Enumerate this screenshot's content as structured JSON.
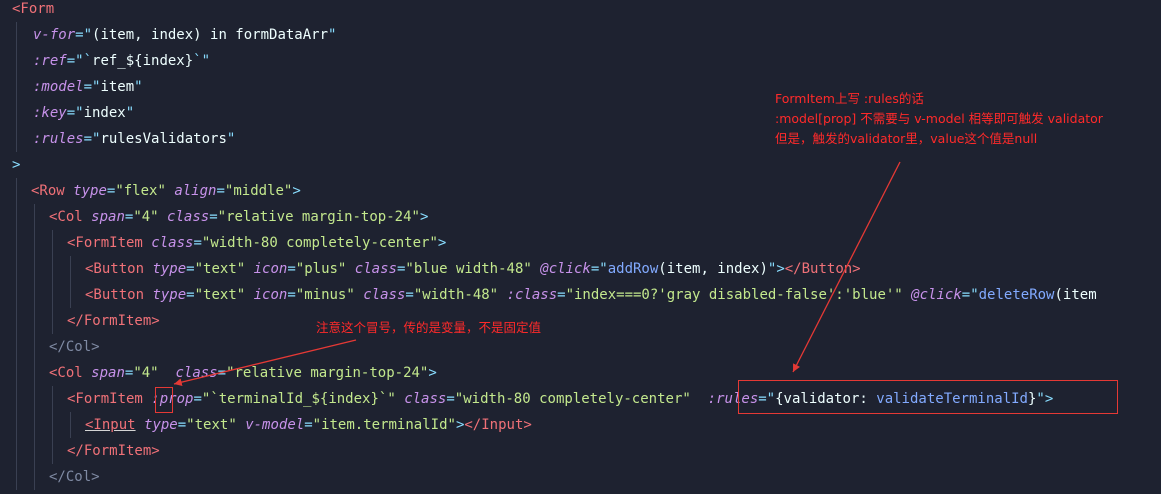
{
  "colors": {
    "background": "#1e2230",
    "tag": "#f07178",
    "attribute": "#c792ea",
    "string": "#c3e88d",
    "punctuation": "#89ddff",
    "function": "#82aaff",
    "annotation": "#ff2a2a"
  },
  "code": {
    "l1_tag": "<Form",
    "l2_attr": "v-for",
    "l2_eq": "=\"",
    "l2_val": "(item, index) in formDataArr",
    "l2_q": "\"",
    "l3_attr": ":ref",
    "l3_eq": "=\"`",
    "l3_val": "ref_${index}",
    "l3_q": "`\"",
    "l4_attr": ":model",
    "l4_eq": "=\"",
    "l4_val": "item",
    "l4_q": "\"",
    "l5_attr": ":key",
    "l5_eq": "=\"",
    "l5_val": "index",
    "l5_q": "\"",
    "l6_attr": ":rules",
    "l6_eq": "=\"",
    "l6_val": "rulesValidators",
    "l6_q": "\"",
    "l7_close": ">",
    "l8_tag": "<Row",
    "l8_a1": "type",
    "l8_v1": "\"flex\"",
    "l8_a2": "align",
    "l8_v2": "\"middle\"",
    "l8_end": ">",
    "l9_tag": "<Col",
    "l9_a1": "span",
    "l9_v1": "\"4\"",
    "l9_a2": "class",
    "l9_v2": "\"relative margin-top-24\"",
    "l9_end": ">",
    "l10_tag": "<FormItem",
    "l10_a1": "class",
    "l10_v1": "\"width-80 completely-center\"",
    "l10_end": ">",
    "l11_tag": "<Button",
    "l11_a1": "type",
    "l11_v1": "\"text\"",
    "l11_a2": "icon",
    "l11_v2": "\"plus\"",
    "l11_a3": "class",
    "l11_v3": "\"blue width-48\"",
    "l11_a4": "@click",
    "l11_q1": "\"",
    "l11_fn": "addRow",
    "l11_args": "(item, index)",
    "l11_q2": "\"",
    "l11_gt": ">",
    "l11_close": "</Button>",
    "l12_tag": "<Button",
    "l12_a1": "type",
    "l12_v1": "\"text\"",
    "l12_a2": "icon",
    "l12_v2": "\"minus\"",
    "l12_a3": "class",
    "l12_v3": "\"width-48\"",
    "l12_a4": ":class",
    "l12_v4": "\"index===0?'gray disabled-false':'blue'\"",
    "l12_a5": "@click",
    "l12_q1": "\"",
    "l12_fn": "deleteRow",
    "l12_args": "(item",
    "l13_close": "</FormItem>",
    "l14_close": "</Col>",
    "l15_tag": "<Col",
    "l15_a1": "span",
    "l15_v1": "\"4\"",
    "l15_a2": "class",
    "l15_v2": "\"relative margin-top-24\"",
    "l15_end": ">",
    "l16_tag": "<FormItem",
    "l16_a1": ":prop",
    "l16_v1": "\"`terminalId_${index}`\"",
    "l16_a2": "class",
    "l16_v2": "\"width-80 completely-center\"",
    "l16_a3": ":rules",
    "l16_q1": "=\"",
    "l16_obj1": "{validator: ",
    "l16_fn": "validateTerminalId",
    "l16_obj2": "}",
    "l16_q2": "\"",
    "l16_end": ">",
    "l17_tag": "<Input",
    "l17_a1": "type",
    "l17_v1": "\"text\"",
    "l17_a2": "v-model",
    "l17_v2": "\"item.terminalId\"",
    "l17_end": ">",
    "l17_close": "</Input>",
    "l18_close": "</FormItem>",
    "l19_close": "</Col>"
  },
  "annotations": {
    "note1_line1": "FormItem上写 :rules的话",
    "note1_line2": ":model[prop] 不需要与 v-model 相等即可触发 validator",
    "note1_line3": "但是，触发的validator里，value这个值是null",
    "note2": "注意这个冒号，传的是变量，不是固定值"
  }
}
